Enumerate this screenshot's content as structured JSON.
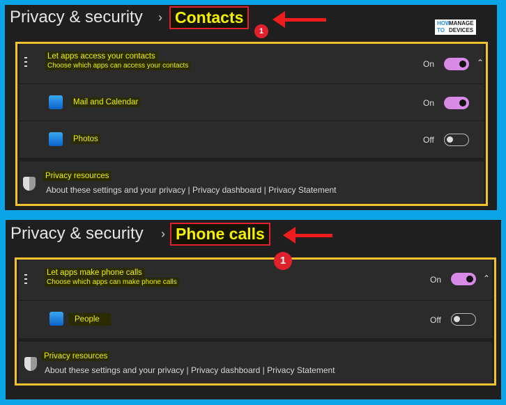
{
  "panels": [
    {
      "breadcrumb_parent": "Privacy & security",
      "breadcrumb_current": "Contacts",
      "callout_number": "1",
      "main_setting": {
        "title": "Let apps access your contacts",
        "subtitle": "Choose which apps can access your contacts",
        "state": "On",
        "on": true
      },
      "apps": [
        {
          "name": "Mail and Calendar",
          "icon": "mail-icon",
          "state": "On",
          "on": true
        },
        {
          "name": "Photos",
          "icon": "photos-icon",
          "state": "Off",
          "on": false
        }
      ],
      "resources": {
        "title": "Privacy resources",
        "links": [
          "About these settings and your privacy",
          "Privacy dashboard",
          "Privacy Statement"
        ]
      }
    },
    {
      "breadcrumb_parent": "Privacy & security",
      "breadcrumb_current": "Phone calls",
      "callout_number": "1",
      "main_setting": {
        "title": "Let apps make phone calls",
        "subtitle": "Choose which apps can make phone calls",
        "state": "On",
        "on": true
      },
      "apps": [
        {
          "name": "People",
          "icon": "people-icon",
          "state": "Off",
          "on": false
        }
      ],
      "resources": {
        "title": "Privacy resources",
        "links": [
          "About these settings and your privacy",
          "Privacy dashboard",
          "Privacy Statement"
        ]
      }
    }
  ],
  "logo": {
    "text_left": "HOW TO",
    "text_right": "MANAGE DEVICES"
  },
  "separator": "|",
  "breadcrumb_chevron": "›",
  "colors": {
    "background": "#0aa5e6",
    "panel": "#1f1f1f",
    "toggle_on": "#d98ae6",
    "highlight_box": "#f2c12e",
    "callout": "#e0202a",
    "highlight_text": "#eef000"
  }
}
